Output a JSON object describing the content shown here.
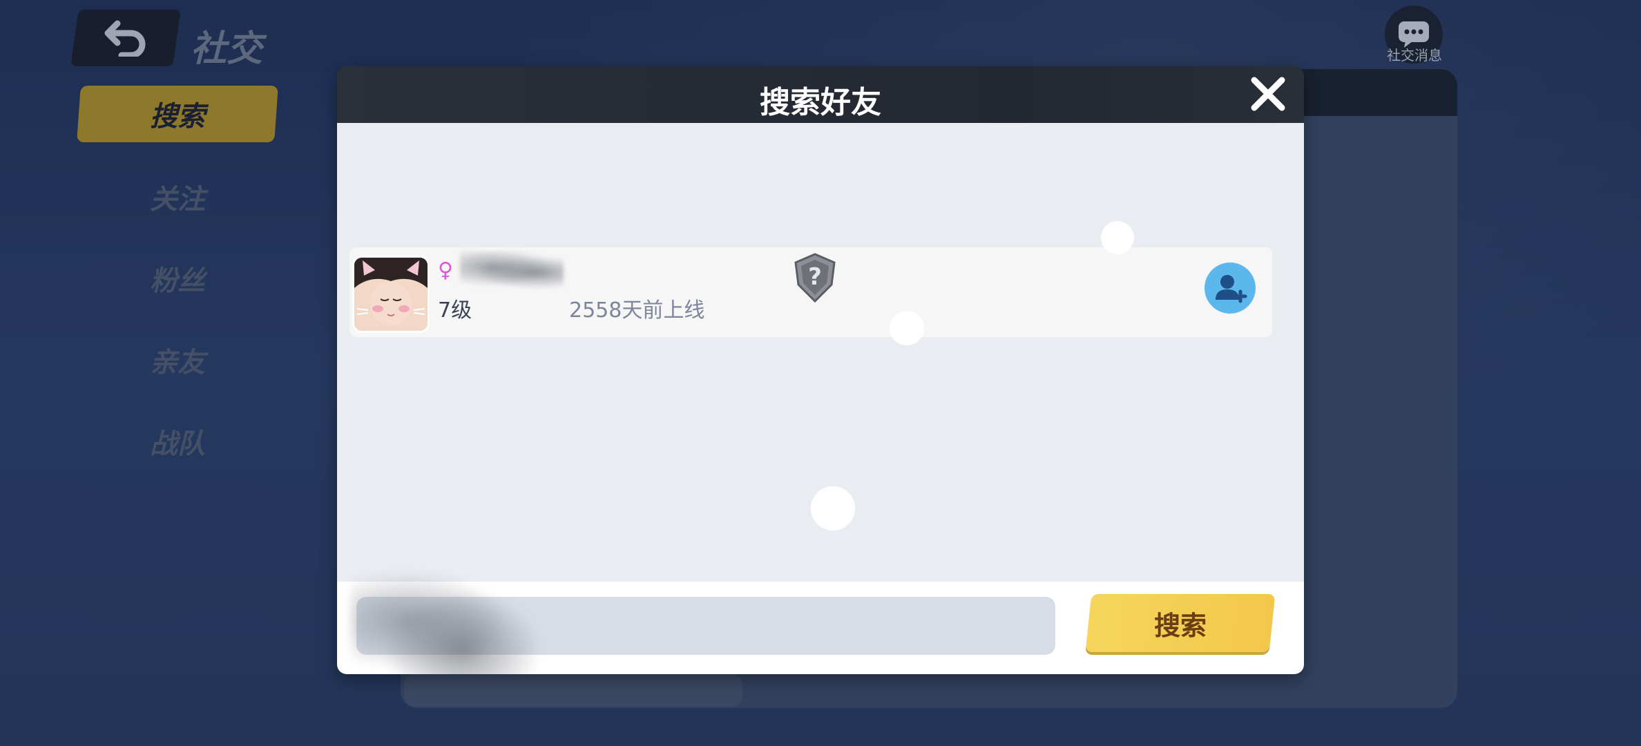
{
  "top_bar": {
    "title": "社交",
    "messages_label": "社交消息"
  },
  "sidebar": {
    "items": [
      {
        "label": "搜索",
        "active": true
      },
      {
        "label": "关注",
        "active": false
      },
      {
        "label": "粉丝",
        "active": false
      },
      {
        "label": "亲友",
        "active": false
      },
      {
        "label": "战队",
        "active": false
      }
    ]
  },
  "dialog": {
    "title": "搜索好友",
    "result": {
      "gender_symbol": "♀",
      "level": "7级",
      "last_online": "2558天前上线"
    },
    "search_input": {
      "value": "",
      "placeholder": ""
    },
    "search_button_label": "搜索"
  },
  "colors": {
    "accent_yellow": "#f6d55c",
    "active_tab": "#b89a2e",
    "add_friend_blue": "#5bb7ec",
    "female_pink": "#e055d9"
  }
}
